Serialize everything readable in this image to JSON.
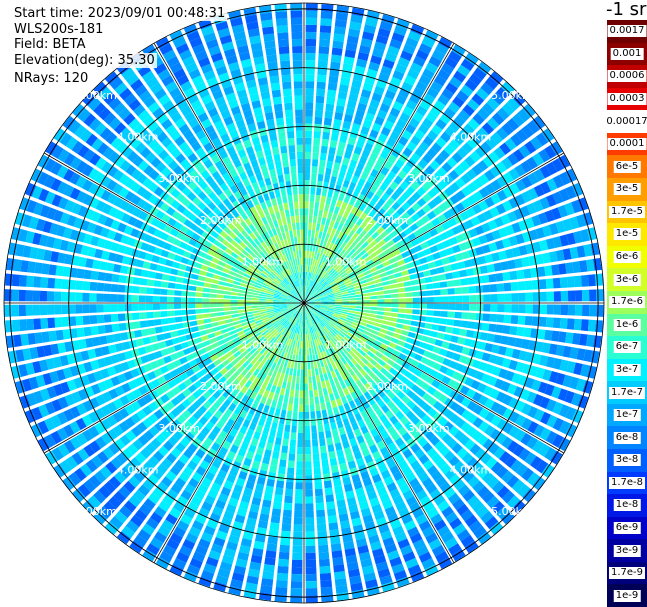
{
  "info": {
    "start_time": "Start time: 2023/09/01 00:48:31",
    "instrument": "WLS200s-181",
    "field": "Field: BETA",
    "elevation": "Elevation(deg): 35.30",
    "nrays": "NRays: 120"
  },
  "colorbar": {
    "unit": "-1 sr",
    "labels": [
      "0.0017",
      "0.001",
      "0.0006",
      "0.0003",
      "0.00017",
      "0.0001",
      "6e-5",
      "3e-5",
      "1.7e-5",
      "1e-5",
      "6e-6",
      "3e-6",
      "1.7e-6",
      "1e-6",
      "6e-7",
      "3e-7",
      "1.7e-7",
      "1e-7",
      "6e-8",
      "3e-8",
      "1.7e-8",
      "1e-8",
      "6e-9",
      "3e-9",
      "1.7e-9",
      "1e-9"
    ],
    "colors": [
      "#6e0000",
      "#8c0000",
      "#c00000",
      "#e60000",
      "#ffffff",
      "#ff3c00",
      "#ff7800",
      "#ff9e00",
      "#ffc400",
      "#ffe800",
      "#f2ff00",
      "#d2ff2a",
      "#9cff5c",
      "#5cffa0",
      "#2affd4",
      "#00f0ff",
      "#00ccff",
      "#00a8ff",
      "#0084ff",
      "#0060ff",
      "#003cff",
      "#0018e6",
      "#0000c8",
      "#0000a0",
      "#00007a",
      "#000056"
    ]
  },
  "chart_data": {
    "type": "heatmap",
    "projection": "polar PPI",
    "field": "BETA",
    "rays": 120,
    "range_unit": "km",
    "range_max_km": 5.0,
    "range_rings_km": [
      1.0,
      2.0,
      3.0,
      4.0,
      5.0
    ],
    "ring_labels": [
      "1.00km",
      "2.00km",
      "3.00km",
      "4.00km",
      "5.00km"
    ],
    "spokes_deg": [
      0,
      30,
      60,
      90,
      120,
      150,
      180,
      210,
      240,
      270,
      300,
      330
    ],
    "value_bands": [
      {
        "range_km": [
          0.0,
          0.5
        ],
        "typical": "1e-6",
        "colors": [
          "#2affd4",
          "#5cffa0",
          "#00f0ff"
        ]
      },
      {
        "range_km": [
          0.5,
          1.8
        ],
        "typical": "1.7e-6",
        "colors": [
          "#9cff5c",
          "#5cffa0",
          "#2affd4"
        ]
      },
      {
        "range_km": [
          1.8,
          3.0
        ],
        "typical": "6e-7",
        "colors": [
          "#2affd4",
          "#00f0ff",
          "#00ccff"
        ]
      },
      {
        "range_km": [
          3.0,
          4.2
        ],
        "typical": "3e-7",
        "colors": [
          "#00f0ff",
          "#00ccff",
          "#00a8ff"
        ]
      },
      {
        "range_km": [
          4.2,
          5.2
        ],
        "typical": "1e-7",
        "colors": [
          "#00ccff",
          "#00a8ff",
          "#0084ff",
          "#0060ff"
        ]
      }
    ]
  }
}
